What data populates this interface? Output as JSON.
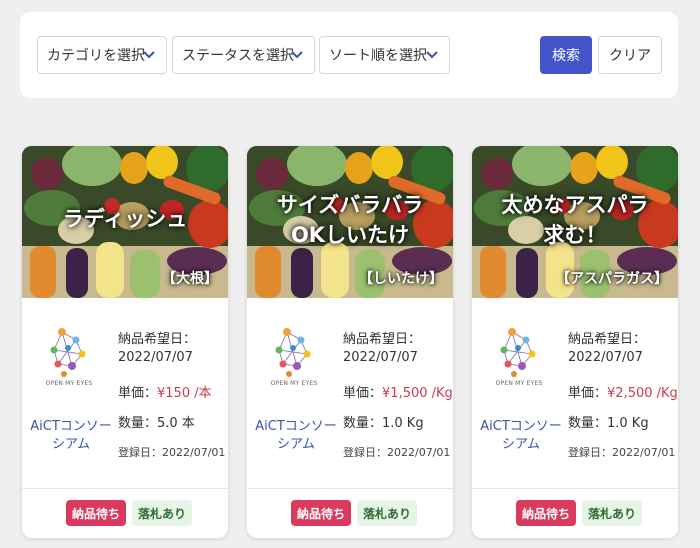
{
  "filters": {
    "category": "カテゴリを選択",
    "status": "ステータスを選択",
    "sort": "ソート順を選択",
    "search_label": "検索",
    "clear_label": "クリア"
  },
  "cards": [
    {
      "title_lines": [
        "ラディッシュ"
      ],
      "tag": "【大根】",
      "logo_text": "OPEN MY EYES",
      "org_lines": [
        "AiCTコンソー",
        "シアム"
      ],
      "delivery_label": "納品希望日：",
      "delivery_date": "2022/07/07",
      "price_label": "単価：",
      "price_value": "¥150 /本",
      "qty": "数量：5.0 本",
      "registered": "登録日：2022/07/01",
      "status_badge": "納品待ち",
      "bid_badge": "落札あり"
    },
    {
      "title_lines": [
        "サイズバラバラ",
        "OKしいたけ"
      ],
      "tag": "【しいたけ】",
      "logo_text": "OPEN MY EYES",
      "org_lines": [
        "AiCTコンソー",
        "シアム"
      ],
      "delivery_label": "納品希望日：",
      "delivery_date": "2022/07/07",
      "price_label": "単価：",
      "price_value": "¥1,500 /Kg",
      "qty": "数量：1.0 Kg",
      "registered": "登録日：2022/07/01",
      "status_badge": "納品待ち",
      "bid_badge": "落札あり"
    },
    {
      "title_lines": [
        "太めなアスパラ",
        "求む！"
      ],
      "tag": "【アスパラガス】",
      "logo_text": "OPEN MY EYES",
      "org_lines": [
        "AiCTコンソー",
        "シアム"
      ],
      "delivery_label": "納品希望日：",
      "delivery_date": "2022/07/07",
      "price_label": "単価：",
      "price_value": "¥2,500 /Kg",
      "qty": "数量：1.0 Kg",
      "registered": "登録日：2022/07/01",
      "status_badge": "納品待ち",
      "bid_badge": "落札あり"
    }
  ],
  "colors": {
    "primary": "#4355c8",
    "price_red": "#d1384d",
    "status_badge_bg": "#d93a5e",
    "bid_badge_bg": "#e6f5e7",
    "org_link": "#3c54a5"
  },
  "icons": {
    "select_chevron": "chevron-down-icon",
    "logo": "open-my-eyes-logo"
  }
}
